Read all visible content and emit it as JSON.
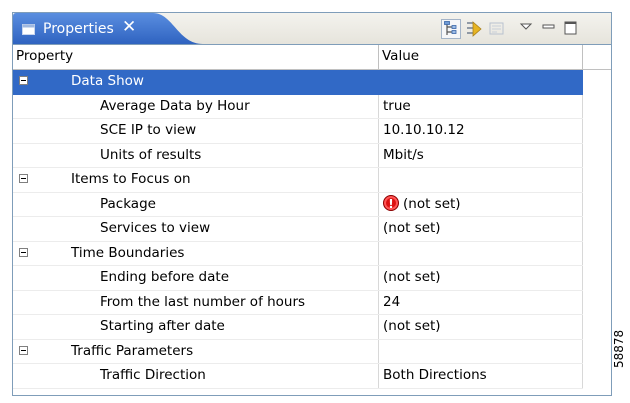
{
  "view": {
    "title": "Properties",
    "close_glyph": "✕",
    "toolbar": [
      {
        "name": "show-categories-icon",
        "pressed": true
      },
      {
        "name": "show-advanced-icon",
        "pressed": false
      },
      {
        "name": "restore-default-icon",
        "pressed": false
      },
      {
        "name": "view-menu-icon",
        "pressed": false
      },
      {
        "name": "minimize-icon",
        "pressed": false
      },
      {
        "name": "maximize-icon",
        "pressed": false
      }
    ]
  },
  "columns": {
    "property": "Property",
    "value": "Value"
  },
  "rows": [
    {
      "type": "category",
      "label": "Data Show",
      "value": "",
      "selected": true
    },
    {
      "type": "item",
      "label": "Average Data by Hour",
      "value": "true"
    },
    {
      "type": "item",
      "label": "SCE IP to view",
      "value": "10.10.10.12"
    },
    {
      "type": "item",
      "label": "Units of results",
      "value": "Mbit/s"
    },
    {
      "type": "category",
      "label": "Items to Focus on",
      "value": ""
    },
    {
      "type": "item",
      "label": "Package",
      "value": "(not set)",
      "error": true
    },
    {
      "type": "item",
      "label": "Services to view",
      "value": "(not set)"
    },
    {
      "type": "category",
      "label": "Time Boundaries",
      "value": ""
    },
    {
      "type": "item",
      "label": "Ending before date",
      "value": "(not set)"
    },
    {
      "type": "item",
      "label": "From the last number of hours",
      "value": "24"
    },
    {
      "type": "item",
      "label": "Starting after date",
      "value": "(not set)"
    },
    {
      "type": "category",
      "label": "Traffic Parameters",
      "value": ""
    },
    {
      "type": "item",
      "label": "Traffic Direction",
      "value": "Both Directions"
    }
  ],
  "figure_id": "58878",
  "colors": {
    "tab": "#3169c6",
    "selection": "#3169c6",
    "error": "#dd1111"
  }
}
